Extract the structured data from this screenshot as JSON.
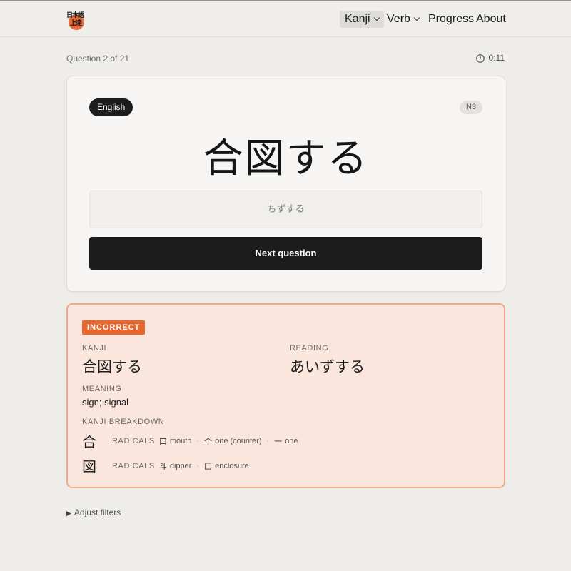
{
  "header": {
    "logo": {
      "top_text": "日本語",
      "bottom_text": "上達",
      "accent_color": "#e66a3a"
    },
    "nav": [
      {
        "label": "Kanji",
        "active": true,
        "dropdown": true
      },
      {
        "label": "Verb",
        "active": false,
        "dropdown": true
      },
      {
        "label": "Progress",
        "active": false,
        "dropdown": false
      },
      {
        "label": "About",
        "active": false,
        "dropdown": false
      }
    ]
  },
  "quiz": {
    "progress_text": "Question 2 of 21",
    "timer": "0:11",
    "mode_pill": "English",
    "level_pill": "N3",
    "prompt": "合図する",
    "answer_value": "ちずする",
    "next_button": "Next question"
  },
  "result": {
    "status": "INCORRECT",
    "kanji_label": "KANJI",
    "kanji_value": "合図する",
    "reading_label": "READING",
    "reading_value": "あいずする",
    "meaning_label": "MEANING",
    "meaning_value": "sign; signal",
    "breakdown_label": "KANJI BREAKDOWN",
    "breakdown": [
      {
        "kanji": "合",
        "radicals_label": "RADICALS",
        "radicals": [
          {
            "glyph": "口",
            "meaning": "mouth"
          },
          {
            "glyph": "个",
            "meaning": "one (counter)"
          },
          {
            "glyph": "一",
            "meaning": "one"
          }
        ]
      },
      {
        "kanji": "図",
        "radicals_label": "RADICALS",
        "radicals": [
          {
            "glyph": "斗",
            "meaning": "dipper"
          },
          {
            "glyph": "囗",
            "meaning": "enclosure"
          }
        ]
      }
    ],
    "colors": {
      "badge": "#e8672f",
      "panel_bg": "#fbe6de",
      "panel_border": "#f0a98c"
    }
  },
  "filters": {
    "toggle_label": "Adjust filters"
  }
}
